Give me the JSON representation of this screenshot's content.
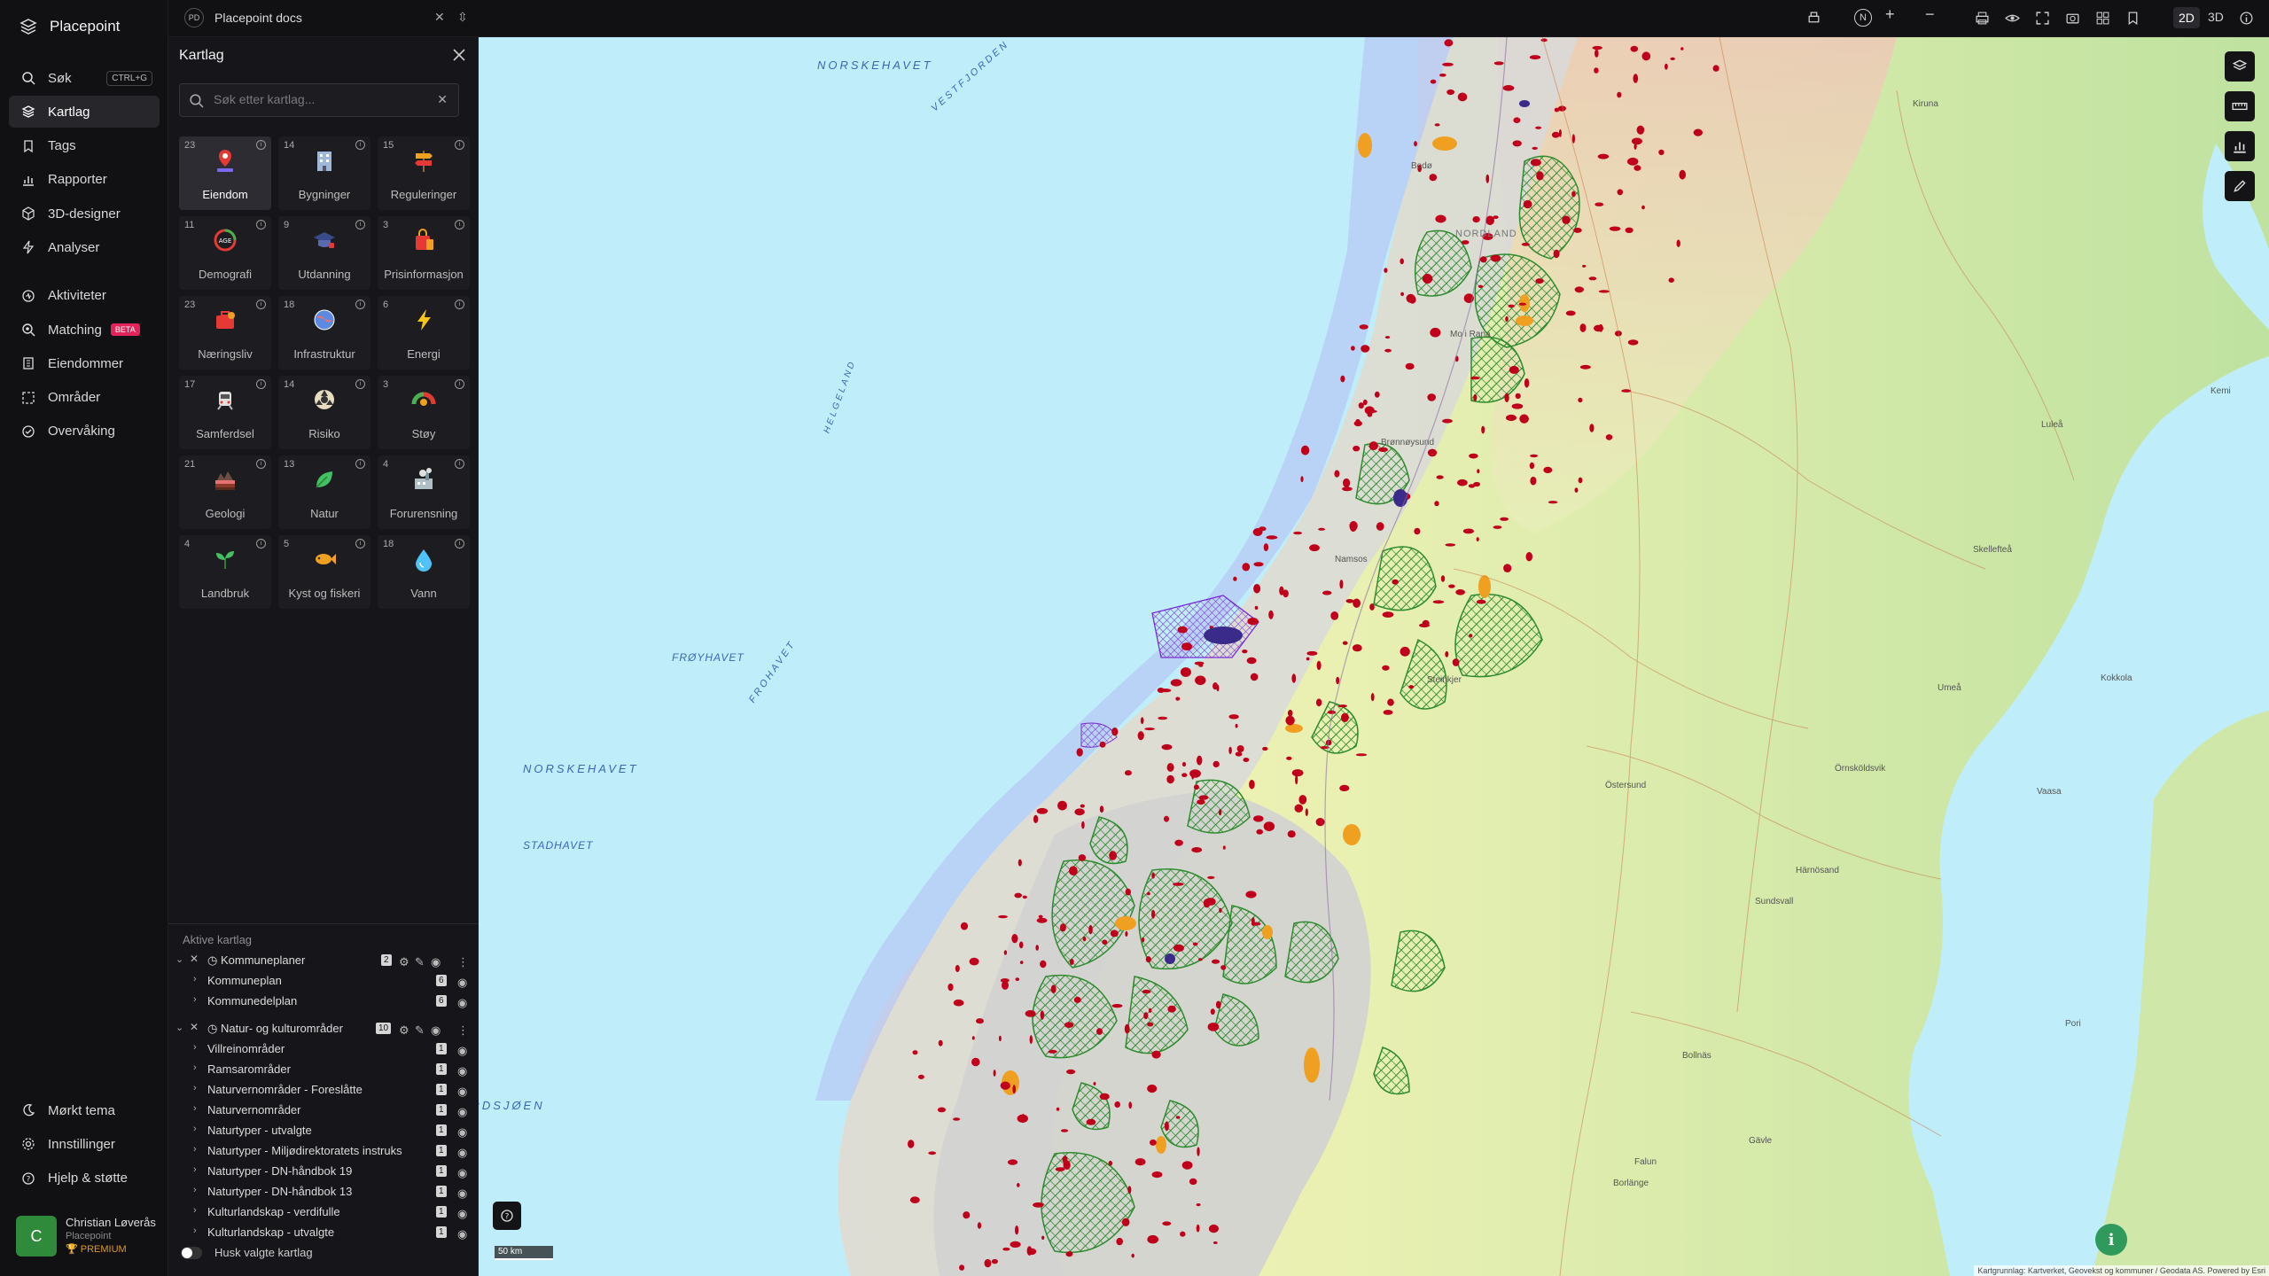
{
  "brand": {
    "name": "Placepoint"
  },
  "nav": {
    "items": [
      {
        "label": "Søk",
        "shortcut": "CTRL+G",
        "icon": "search-icon"
      },
      {
        "label": "Kartlag",
        "icon": "layers-icon",
        "active": true
      },
      {
        "label": "Tags",
        "icon": "bookmark-icon"
      },
      {
        "label": "Rapporter",
        "icon": "bar-chart-icon"
      },
      {
        "label": "3D-designer",
        "icon": "cube-icon"
      },
      {
        "label": "Analyser",
        "icon": "bolt-icon"
      }
    ],
    "items2": [
      {
        "label": "Aktiviteter",
        "icon": "activity-icon"
      },
      {
        "label": "Matching",
        "badge": "BETA",
        "icon": "match-icon"
      },
      {
        "label": "Eiendommer",
        "icon": "building-icon"
      },
      {
        "label": "Områder",
        "icon": "area-icon"
      },
      {
        "label": "Overvåking",
        "icon": "monitor-icon"
      }
    ],
    "bottom": [
      {
        "label": "Mørkt tema",
        "icon": "moon-icon"
      },
      {
        "label": "Innstillinger",
        "icon": "gear-icon"
      },
      {
        "label": "Hjelp & støtte",
        "icon": "help-icon"
      }
    ]
  },
  "user": {
    "initial": "C",
    "name": "Christian Løverås",
    "org": "Placepoint",
    "tier": "PREMIUM"
  },
  "workspace": {
    "badge": "PD",
    "name": "Placepoint docs"
  },
  "toolbar": {
    "north": "N",
    "mode_2d": "2D",
    "mode_3d": "3D"
  },
  "panel": {
    "title": "Kartlag",
    "search_placeholder": "Søk etter kartlag...",
    "tiles": [
      {
        "count": "23",
        "label": "Eiendom",
        "icon": "property-pin-icon",
        "active": true
      },
      {
        "count": "14",
        "label": "Bygninger",
        "icon": "building-icon"
      },
      {
        "count": "15",
        "label": "Reguleringer",
        "icon": "signpost-icon"
      },
      {
        "count": "11",
        "label": "Demografi",
        "icon": "demography-icon"
      },
      {
        "count": "9",
        "label": "Utdanning",
        "icon": "graduation-cap-icon"
      },
      {
        "count": "3",
        "label": "Prisinformasjon",
        "icon": "shopping-bag-icon"
      },
      {
        "count": "23",
        "label": "Næringsliv",
        "icon": "business-bag-icon"
      },
      {
        "count": "18",
        "label": "Infrastruktur",
        "icon": "globe-icon"
      },
      {
        "count": "6",
        "label": "Energi",
        "icon": "lightning-icon"
      },
      {
        "count": "17",
        "label": "Samferdsel",
        "icon": "train-icon"
      },
      {
        "count": "14",
        "label": "Risiko",
        "icon": "hazard-icon"
      },
      {
        "count": "3",
        "label": "Støy",
        "icon": "noise-gauge-icon"
      },
      {
        "count": "21",
        "label": "Geologi",
        "icon": "geology-icon"
      },
      {
        "count": "13",
        "label": "Natur",
        "icon": "leaf-icon"
      },
      {
        "count": "4",
        "label": "Forurensning",
        "icon": "factory-icon"
      },
      {
        "count": "4",
        "label": "Landbruk",
        "icon": "sprout-icon"
      },
      {
        "count": "5",
        "label": "Kyst og fiskeri",
        "icon": "fish-icon"
      },
      {
        "count": "18",
        "label": "Vann",
        "icon": "water-drop-icon"
      }
    ],
    "active_header": "Aktive kartlag",
    "groups": [
      {
        "name": "Kommuneplaner",
        "count": "2",
        "layers": [
          {
            "name": "Kommuneplan",
            "count": "6"
          },
          {
            "name": "Kommunedelplan",
            "count": "6"
          }
        ]
      },
      {
        "name": "Natur- og kulturområder",
        "count": "10",
        "layers": [
          {
            "name": "Villreinområder",
            "count": "1"
          },
          {
            "name": "Ramsarområder",
            "count": "1"
          },
          {
            "name": "Naturvernområder - Foreslåtte",
            "count": "1"
          },
          {
            "name": "Naturvernområder",
            "count": "1"
          },
          {
            "name": "Naturtyper - utvalgte",
            "count": "1"
          },
          {
            "name": "Naturtyper - Miljødirektoratets instruks",
            "count": "1"
          },
          {
            "name": "Naturtyper - DN-håndbok 19",
            "count": "1"
          },
          {
            "name": "Naturtyper - DN-håndbok 13",
            "count": "1"
          },
          {
            "name": "Kulturlandskap - verdifulle",
            "count": "1"
          },
          {
            "name": "Kulturlandskap - utvalgte",
            "count": "1"
          }
        ]
      }
    ],
    "remember_label": "Husk valgte kartlag"
  },
  "map": {
    "sea_labels": [
      "NORSKEHAVET",
      "NORSKEHAVET",
      "FRØYHAVET",
      "NORDSJØEN",
      "STADHAVET",
      "FROHAVET",
      "VESTFJORDEN",
      "HELGELAND"
    ],
    "towns": [
      "Kiruna",
      "Luleå",
      "Skellefteå",
      "Umeå",
      "Örnsköldsvik",
      "Östersund",
      "Härnösand",
      "Sundsvall",
      "Bollnäs",
      "Falun",
      "Borlänge",
      "Gävle",
      "Vaasa",
      "Pori",
      "Kokkola",
      "Kemi",
      "Mo i Rana",
      "Bodø",
      "Brønnøysund",
      "Namsos",
      "Steinkjer",
      "NORDLAND"
    ],
    "scale_label": "50 km",
    "attribution": "Kartgrunnlag: Kartverket, Geovekst og kommuner / Geodata AS. Powered by Esri"
  },
  "colors": {
    "accent": "#2f8a3b",
    "sea": "#bfeefa",
    "land_green": "#cfe7b0",
    "protected": "#2e8b2e",
    "nature_red": "#c0001a"
  }
}
